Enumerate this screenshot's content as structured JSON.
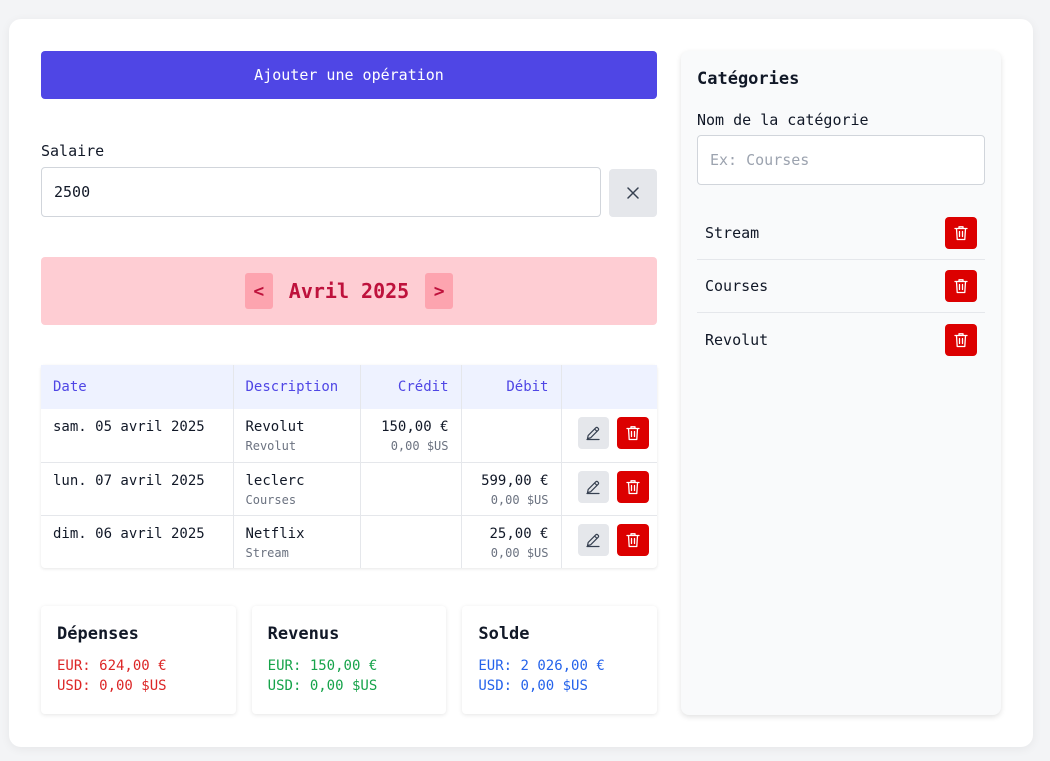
{
  "add_button": "Ajouter une opération",
  "salary": {
    "label": "Salaire",
    "value": "2500"
  },
  "month": {
    "prev": "<",
    "title": "Avril 2025",
    "next": ">"
  },
  "table": {
    "headers": {
      "date": "Date",
      "description": "Description",
      "credit": "Crédit",
      "debit": "Débit"
    },
    "rows": [
      {
        "date": "sam. 05 avril 2025",
        "description": "Revolut",
        "category": "Revolut",
        "credit": "150,00 €",
        "credit_usd": "0,00 $US",
        "debit": "",
        "debit_usd": ""
      },
      {
        "date": "lun. 07 avril 2025",
        "description": "leclerc",
        "category": "Courses",
        "credit": "",
        "credit_usd": "",
        "debit": "599,00 €",
        "debit_usd": "0,00 $US"
      },
      {
        "date": "dim. 06 avril 2025",
        "description": "Netflix",
        "category": "Stream",
        "credit": "",
        "credit_usd": "",
        "debit": "25,00 €",
        "debit_usd": "0,00 $US"
      }
    ]
  },
  "summary": {
    "expenses": {
      "title": "Dépenses",
      "eur": "EUR: 624,00 €",
      "usd": "USD: 0,00 $US"
    },
    "income": {
      "title": "Revenus",
      "eur": "EUR: 150,00 €",
      "usd": "USD: 0,00 $US"
    },
    "balance": {
      "title": "Solde",
      "eur": "EUR: 2 026,00 €",
      "usd": "USD: 0,00 $US"
    }
  },
  "categories": {
    "title": "Catégories",
    "name_label": "Nom de la catégorie",
    "placeholder": "Ex: Courses",
    "items": [
      {
        "name": "Stream"
      },
      {
        "name": "Courses"
      },
      {
        "name": "Revolut"
      }
    ]
  },
  "colors": {
    "primary": "#4f46e5",
    "danger": "#dc0000",
    "month_bg": "#fecdd3",
    "month_text": "#be123c"
  },
  "icons": {
    "clear": "close-icon",
    "edit": "pencil-icon",
    "delete": "trash-icon"
  }
}
